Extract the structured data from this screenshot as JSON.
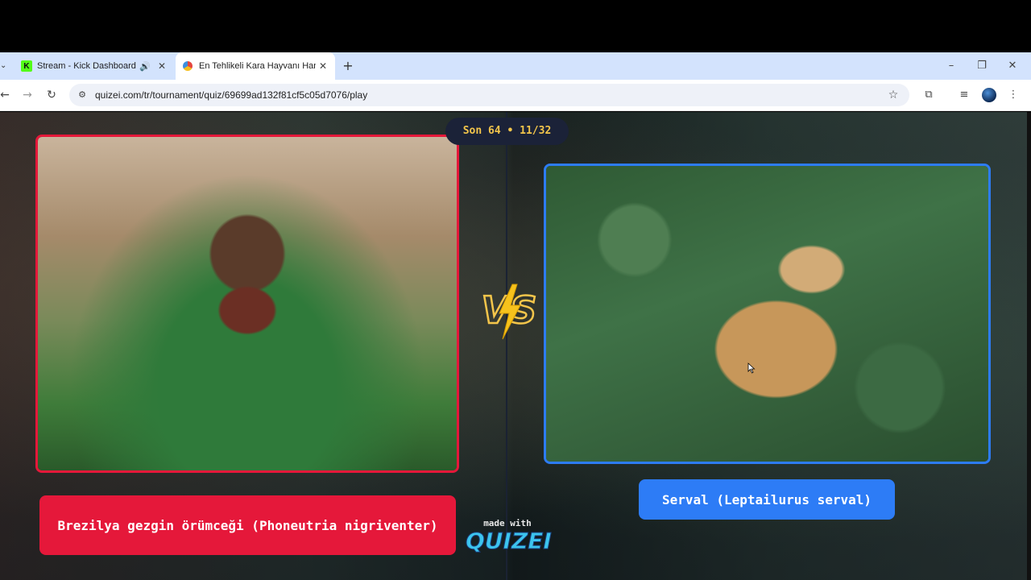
{
  "browser": {
    "tabs": [
      {
        "title": "Stream - Kick Dashboard",
        "favicon": "kick-icon",
        "favicon_letter": "K",
        "active": false,
        "audio": true
      },
      {
        "title": "En Tehlikeli Kara Hayvanı Hangi",
        "favicon": "quizei-icon",
        "active": true,
        "audio": false
      }
    ],
    "new_tab": "+",
    "url": "quizei.com/tr/tournament/quiz/69699ad132f81cf5c05d7076/play",
    "window_controls": {
      "minimize": "–",
      "maximize": "❐",
      "close": "✕"
    }
  },
  "quiz": {
    "round": "Son 64 • 11/32",
    "left": {
      "label": "Brezilya gezgin örümceği (Phoneutria nigriventer)",
      "accent": "#e5183a",
      "image": "spider-photo"
    },
    "right": {
      "label": "Serval (Leptailurus serval)",
      "accent": "#2d7cf6",
      "image": "serval-photo"
    },
    "vs_text": "VS",
    "branding": {
      "made_with": "made with",
      "logo": "QUIZEI"
    }
  },
  "colors": {
    "badge_bg": "#1b2238",
    "badge_text": "#f3c54b",
    "tabstrip": "#d3e3fd"
  }
}
